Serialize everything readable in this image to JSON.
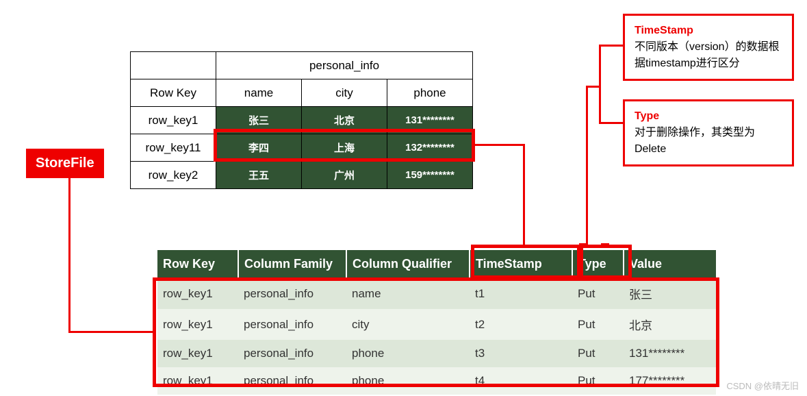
{
  "storefile_label": "StoreFile",
  "top_table": {
    "super_header": "personal_info",
    "headers": {
      "rowkey": "Row Key",
      "c1": "name",
      "c2": "city",
      "c3": "phone"
    },
    "rows": [
      {
        "key": "row_key1",
        "name": "张三",
        "city": "北京",
        "phone": "131********"
      },
      {
        "key": "row_key11",
        "name": "李四",
        "city": "上海",
        "phone": "132********"
      },
      {
        "key": "row_key2",
        "name": "王五",
        "city": "广州",
        "phone": "159********"
      }
    ]
  },
  "bottom_table": {
    "headers": [
      "Row Key",
      "Column Family",
      "Column Qualifier",
      "TimeStamp",
      "Type",
      "Value"
    ],
    "rows": [
      {
        "rk": "row_key1",
        "cf": "personal_info",
        "cq": "name",
        "ts": "t1",
        "type": "Put",
        "val": "张三"
      },
      {
        "rk": "row_key1",
        "cf": "personal_info",
        "cq": "city",
        "ts": "t2",
        "type": "Put",
        "val": "北京"
      },
      {
        "rk": "row_key1",
        "cf": "personal_info",
        "cq": "phone",
        "ts": "t3",
        "type": "Put",
        "val": "131********"
      },
      {
        "rk": "row_key1",
        "cf": "personal_info",
        "cq": "phone",
        "ts": "t4",
        "type": "Put",
        "val": "177********"
      }
    ]
  },
  "callouts": {
    "timestamp": {
      "title": "TimeStamp",
      "desc": "不同版本（version）的数据根据timestamp进行区分"
    },
    "type": {
      "title": "Type",
      "desc": "对于删除操作，其类型为Delete"
    }
  },
  "watermark": "CSDN @依晴无旧"
}
